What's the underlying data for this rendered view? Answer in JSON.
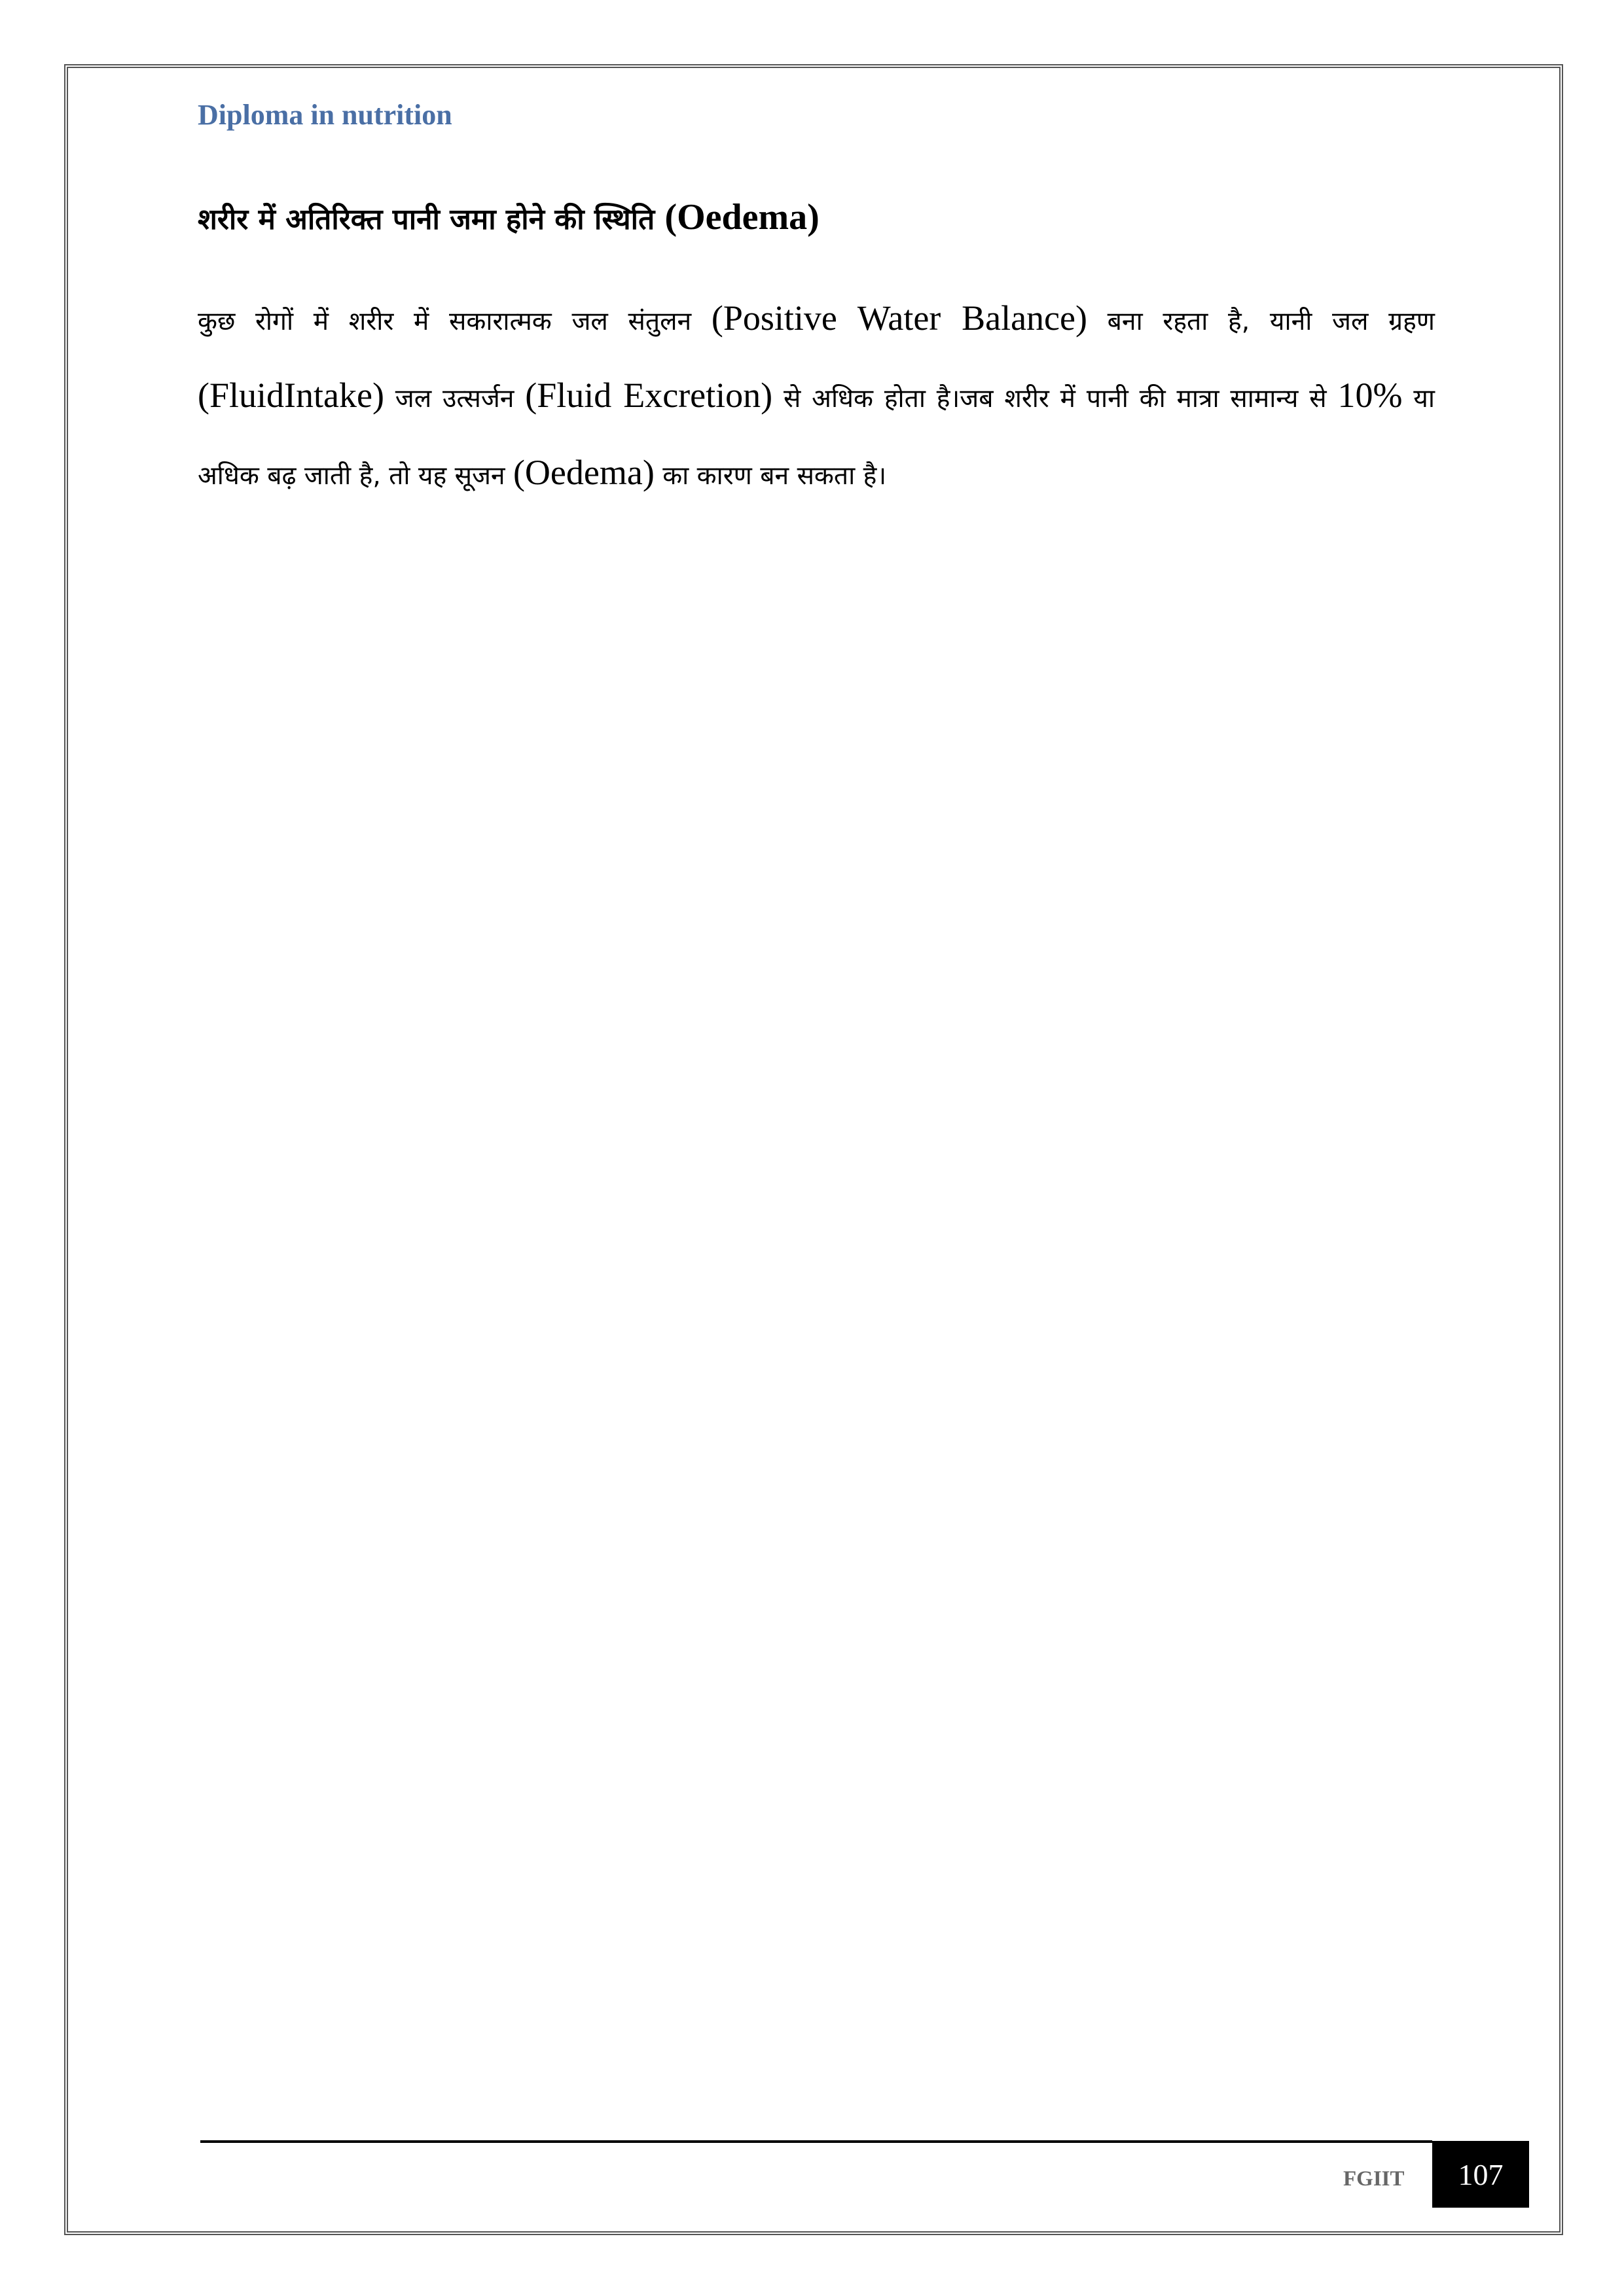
{
  "header": {
    "title": "Diploma in nutrition"
  },
  "section": {
    "heading_hindi": "शरीर में अतिरिक्त पानी जमा होने की स्थिति ",
    "heading_english": "(Oedema)"
  },
  "paragraph": {
    "segments": [
      {
        "lang": "hi",
        "text": "कुछ रोगों में शरीर में सकारात्मक जल संतुलन "
      },
      {
        "lang": "en",
        "text": "(Positive Water Balance)"
      },
      {
        "lang": "hi",
        "text": " बना रहता है, यानी जल ग्रहण "
      },
      {
        "lang": "en",
        "text": "(FluidIntake)"
      },
      {
        "lang": "hi",
        "text": " जल उत्सर्जन "
      },
      {
        "lang": "en",
        "text": "(Fluid Excretion)"
      },
      {
        "lang": "hi",
        "text": " से अधिक होता है।जब शरीर में पानी की मात्रा सामान्य से "
      },
      {
        "lang": "en",
        "text": "10%"
      },
      {
        "lang": "hi",
        "text": " या अधिक बढ़ जाती है, तो यह सूजन "
      },
      {
        "lang": "en",
        "text": "(Oedema)"
      },
      {
        "lang": "hi",
        "text": " का कारण बन सकता है।"
      }
    ]
  },
  "footer": {
    "brand": "FGIIT",
    "page_number": "107"
  }
}
